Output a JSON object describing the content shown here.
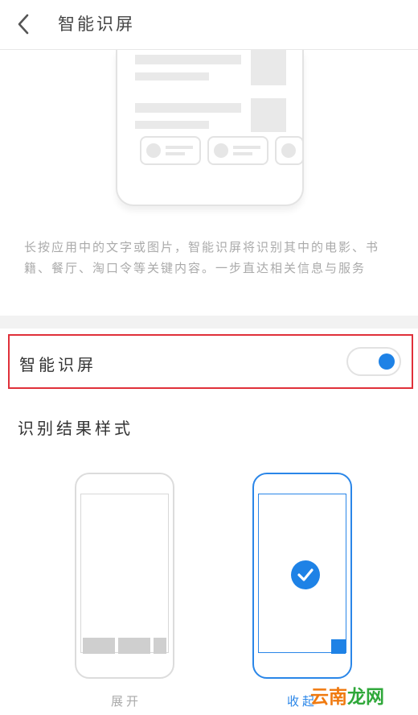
{
  "header": {
    "title": "智能识屏"
  },
  "description": "长按应用中的文字或图片，智能识屏将识别其中的电影、书籍、餐厅、淘口令等关键内容。一步直达相关信息与服务",
  "toggle": {
    "label": "智能识屏",
    "enabled": true,
    "accent_color": "#1e82e6",
    "highlight_color": "#e0303a"
  },
  "result_style": {
    "title": "识别结果样式",
    "options": [
      {
        "label": "展开",
        "selected": false
      },
      {
        "label": "收起",
        "selected": true
      }
    ]
  },
  "watermark": {
    "part1": "云南",
    "part2": "龙网"
  }
}
